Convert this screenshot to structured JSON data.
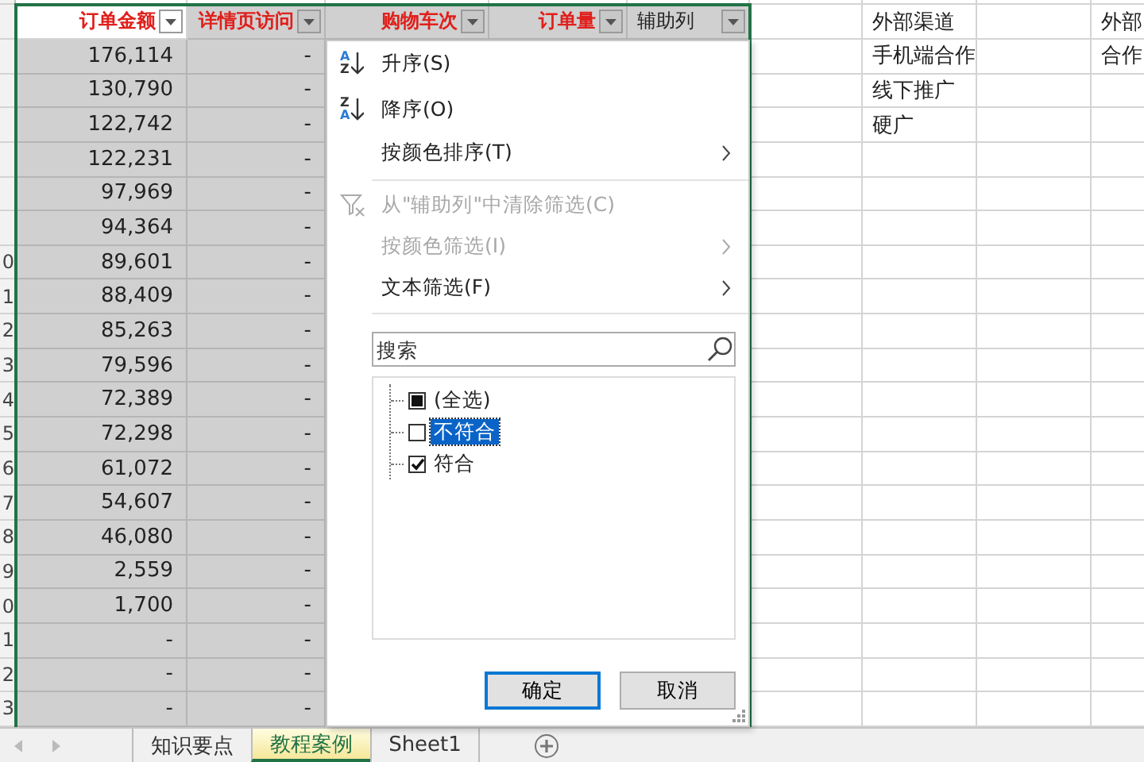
{
  "sheet": {
    "columns": [
      {
        "header": "订单金额",
        "shaded": false
      },
      {
        "header": "详情页访问",
        "shaded": true
      },
      {
        "header": "购物车次",
        "shaded": true
      },
      {
        "header": "订单量",
        "shaded": true
      },
      {
        "header": "辅助列",
        "shaded": true
      }
    ],
    "rows": [
      {
        "cells": [
          "176,114",
          "-"
        ]
      },
      {
        "cells": [
          "130,790",
          "-"
        ]
      },
      {
        "cells": [
          "122,742",
          "-"
        ]
      },
      {
        "cells": [
          "122,231",
          "-"
        ]
      },
      {
        "cells": [
          "97,969",
          "-"
        ]
      },
      {
        "cells": [
          "94,364",
          "-"
        ]
      },
      {
        "row_number": "0",
        "cells": [
          "89,601",
          "-"
        ]
      },
      {
        "row_number": "1",
        "cells": [
          "88,409",
          "-"
        ]
      },
      {
        "row_number": "2",
        "cells": [
          "85,263",
          "-"
        ]
      },
      {
        "row_number": "3",
        "cells": [
          "79,596",
          "-"
        ]
      },
      {
        "row_number": "4",
        "cells": [
          "72,389",
          "-"
        ]
      },
      {
        "row_number": "5",
        "cells": [
          "72,298",
          "-"
        ]
      },
      {
        "row_number": "6",
        "cells": [
          "61,072",
          "-"
        ]
      },
      {
        "row_number": "7",
        "cells": [
          "54,607",
          "-"
        ]
      },
      {
        "row_number": "8",
        "cells": [
          "46,080",
          "-"
        ]
      },
      {
        "row_number": "9",
        "cells": [
          "2,559",
          "-"
        ]
      },
      {
        "row_number": "0",
        "cells": [
          "1,700",
          "-"
        ]
      },
      {
        "row_number": "1",
        "cells": [
          "-",
          "-"
        ]
      },
      {
        "row_number": "2",
        "cells": [
          "-",
          "-"
        ]
      },
      {
        "row_number": "3",
        "cells": [
          "-",
          "-"
        ]
      }
    ],
    "side_rows": [
      {
        "column_7": "外部渠道",
        "column_9": "外部"
      },
      {
        "column_7": "手机端合作",
        "column_9": "合作"
      },
      {
        "column_7": "线下推广"
      },
      {
        "column_7": "硬广"
      }
    ]
  },
  "filter_menu": {
    "items": [
      {
        "kind": "ascending",
        "icon_letters": [
          "A",
          "Z"
        ],
        "label": "升序(S)",
        "disabled": false,
        "submenu": false
      },
      {
        "kind": "descending",
        "icon_letters": [
          "Z",
          "A"
        ],
        "label": "降序(O)",
        "disabled": false,
        "submenu": false
      },
      {
        "kind": "command",
        "label": "按颜色排序(T)",
        "disabled": false,
        "submenu": true
      },
      {
        "kind": "separator"
      },
      {
        "kind": "clear",
        "label": "从\"辅助列\"中清除筛选(C)",
        "disabled": true,
        "submenu": false
      },
      {
        "kind": "command",
        "label": "按颜色筛选(I)",
        "disabled": true,
        "submenu": true
      },
      {
        "kind": "command",
        "label": "文本筛选(F)",
        "disabled": false,
        "submenu": true
      }
    ],
    "search": {
      "placeholder": "搜索"
    },
    "values": [
      {
        "label": "(全选)",
        "checked": false,
        "partial": true,
        "selected": false
      },
      {
        "label": "不符合",
        "checked": false,
        "partial": false,
        "selected": true
      },
      {
        "label": "符合",
        "checked": true,
        "partial": false,
        "selected": false
      }
    ],
    "buttons": [
      {
        "label": "确定",
        "default": true
      },
      {
        "label": "取消",
        "default": false
      }
    ]
  },
  "sheet_tabs": {
    "tabs": [
      {
        "label": "知识要点",
        "selected": false
      },
      {
        "label": "教程案例",
        "selected": true
      },
      {
        "label": "Sheet1",
        "selected": false
      }
    ]
  }
}
